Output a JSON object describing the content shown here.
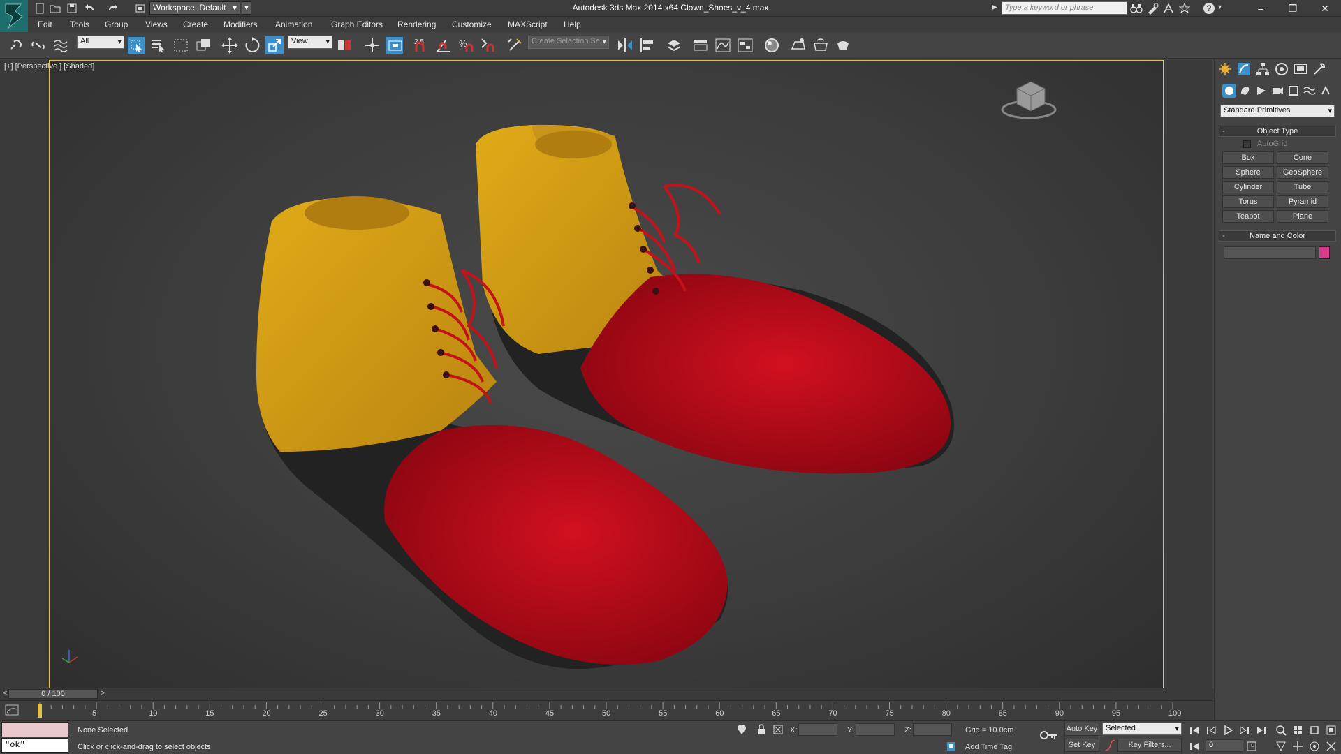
{
  "title_bar": {
    "workspace": "Workspace: Default",
    "title": "Autodesk 3ds Max  2014 x64      Clown_Shoes_v_4.max",
    "search_placeholder": "Type a keyword or phrase",
    "icons": [
      "new-file-icon",
      "open-file-icon",
      "save-icon",
      "undo-icon",
      "redo-icon",
      "project-folder-icon"
    ]
  },
  "menu": [
    "Edit",
    "Tools",
    "Group",
    "Views",
    "Create",
    "Modifiers",
    "Animation",
    "Graph Editors",
    "Rendering",
    "Customize",
    "MAXScript",
    "Help"
  ],
  "toolbar": {
    "selection_filter": "All",
    "ref_coord": "View",
    "snap_angle_label": "2.5",
    "named_selection_placeholder": "Create Selection Se"
  },
  "viewport": {
    "label": "[+] [Perspective ] [Shaded]",
    "colors": {
      "shoe_yellow": "#d9a312",
      "shoe_red": "#c0091a",
      "laces": "#c4121b",
      "sole": "#2a2a2a",
      "border": "#e2c34a"
    }
  },
  "command_panel": {
    "category": "Standard Primitives",
    "object_type": {
      "title": "Object Type",
      "autogrid_label": "AutoGrid",
      "buttons": [
        "Box",
        "Cone",
        "Sphere",
        "GeoSphere",
        "Cylinder",
        "Tube",
        "Torus",
        "Pyramid",
        "Teapot",
        "Plane"
      ]
    },
    "name_and_color": {
      "title": "Name and Color",
      "name_value": "",
      "swatch_color": "#d63c8e"
    }
  },
  "timeline": {
    "slider_label": "0 / 100",
    "left_arrow": "<",
    "right_arrow": ">",
    "ticks": [
      "5",
      "10",
      "15",
      "20",
      "25",
      "30",
      "35",
      "40",
      "45",
      "50",
      "55",
      "60",
      "65",
      "70",
      "75",
      "80",
      "85",
      "90",
      "95",
      "100"
    ]
  },
  "status": {
    "maxscript_output": "\"ok\"",
    "selection_status": "None Selected",
    "prompt": "Click or click-and-drag to select objects",
    "x_label": "X:",
    "y_label": "Y:",
    "z_label": "Z:",
    "grid": "Grid = 10.0cm",
    "add_time_tag": "Add Time Tag",
    "auto_key": "Auto Key",
    "set_key": "Set Key",
    "key_mode": "Selected",
    "key_filters": "Key Filters...",
    "current_frame": "0"
  }
}
